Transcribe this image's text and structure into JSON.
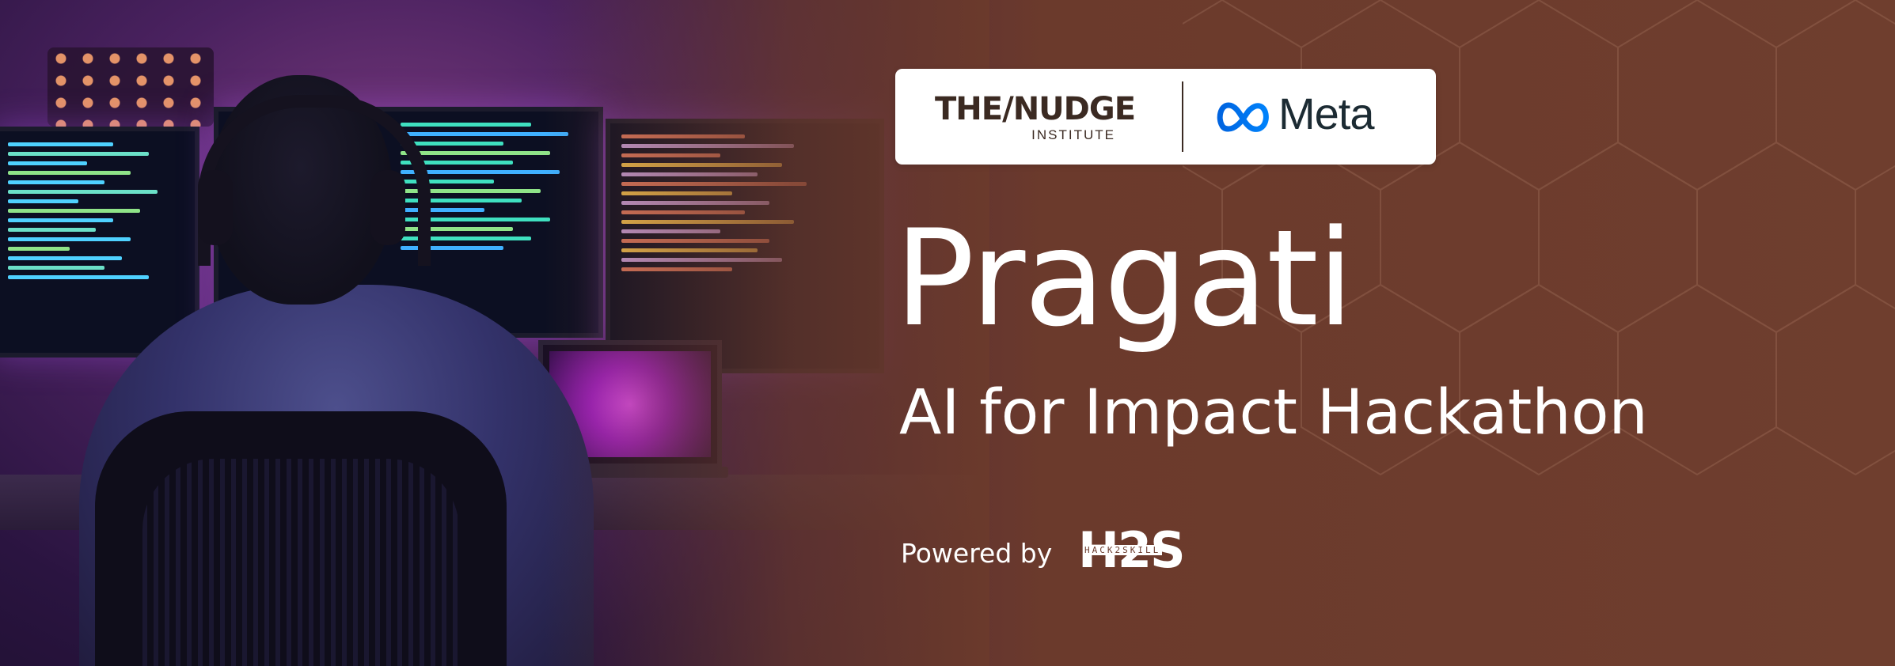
{
  "partners": {
    "nudge_main": "THE/NUDGE",
    "nudge_sub": "INSTITUTE",
    "meta_name": "Meta"
  },
  "event": {
    "title": "Pragati",
    "subtitle": "AI for Impact Hackathon"
  },
  "sponsor": {
    "powered_label": "Powered by",
    "h2s_main": "H2S",
    "h2s_tagline": "HACK2SKILL"
  },
  "colors": {
    "background": "#6b3a2c",
    "meta_blue": "#0668E1",
    "text": "#ffffff"
  },
  "icons": [
    "meta-infinity-icon",
    "h2s-logo"
  ]
}
